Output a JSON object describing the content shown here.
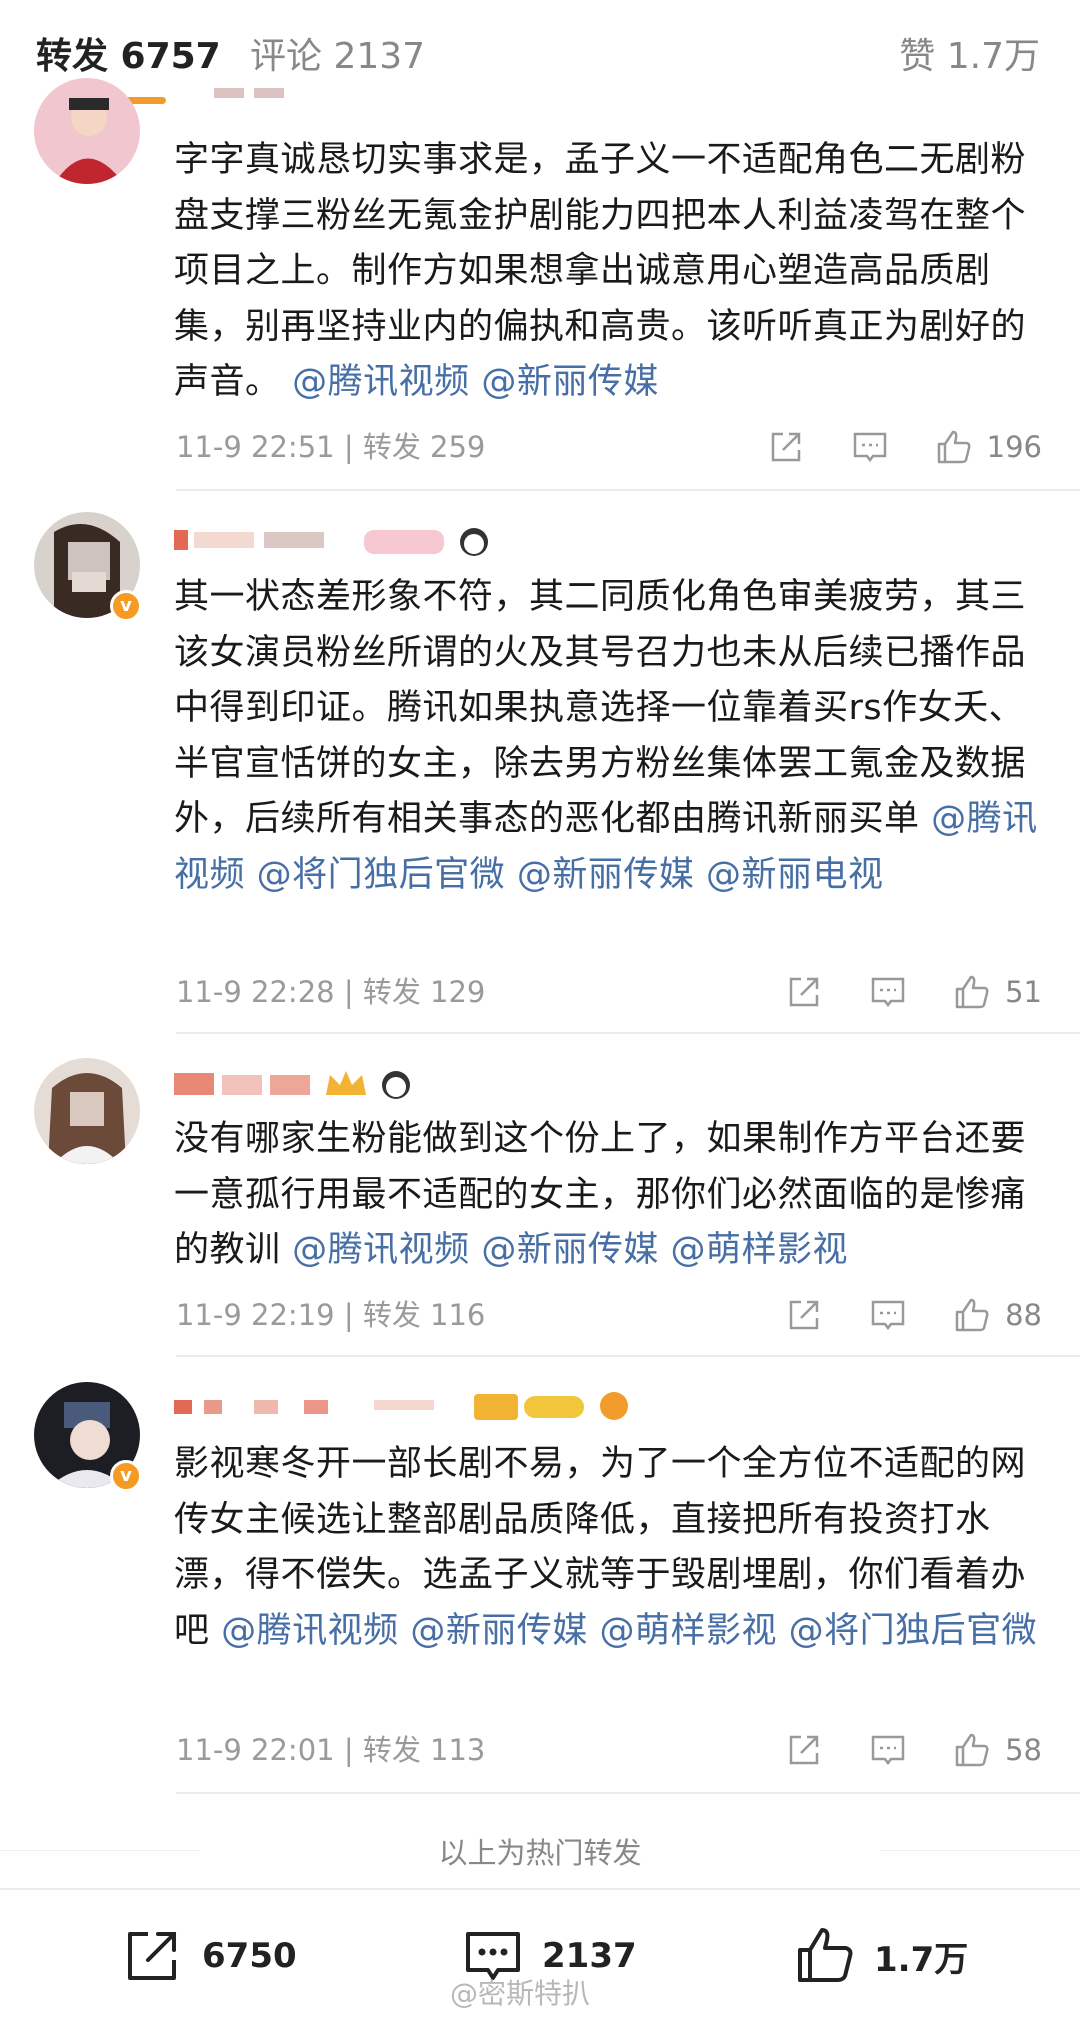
{
  "tabs": {
    "repost_label": "转发 6757",
    "comment_label": "评论 2137",
    "like_label": "赞 1.7万"
  },
  "items": [
    {
      "text": "字字真诚恳切实事求是，孟子义一不适配角色二无剧粉盘支撑三粉丝无氪金护剧能力四把本人利益凌驾在整个项目之上。制作方如果想拿出诚意用心塑造高品质剧集，别再坚持业内的偏执和高贵。该听听真正为剧好的声音。",
      "mentions": [
        "@腾讯视频",
        "@新丽传媒"
      ],
      "meta": "11-9 22:51 | 转发 259",
      "likes": "196"
    },
    {
      "text": "其一状态差形象不符，其二同质化角色审美疲劳，其三该女演员粉丝所谓的火及其号召力也未从后续已播作品中得到印证。腾讯如果执意选择一位靠着买rs作女夭、半官宣恬饼的女主，除去男方粉丝集体罢工氪金及数据外，后续所有相关事态的恶化都由腾讯新丽买单",
      "mentions": [
        "@腾讯视频",
        "@将门独后官微",
        "@新丽传媒",
        "@新丽电视"
      ],
      "meta": "11-9 22:28 | 转发 129",
      "likes": "51"
    },
    {
      "text": "没有哪家生粉能做到这个份上了，如果制作方平台还要一意孤行用最不适配的女主，那你们必然面临的是惨痛的教训",
      "mentions": [
        "@腾讯视频",
        "@新丽传媒",
        "@萌样影视"
      ],
      "meta": "11-9 22:19 | 转发 116",
      "likes": "88"
    },
    {
      "text": "影视寒冬开一部长剧不易，为了一个全方位不适配的网传女主候选让整部剧品质降低，直接把所有投资打水漂，得不偿失。选孟子义就等于毁剧埋剧，你们看着办吧",
      "mentions": [
        "@腾讯视频",
        "@新丽传媒",
        "@萌样影视",
        "@将门独后官微"
      ],
      "meta": "11-9 22:01 | 转发 113",
      "likes": "58"
    }
  ],
  "hot_note": "以上为热门转发",
  "bottom": {
    "repost_count": "6750",
    "comment_count": "2137",
    "like_count": "1.7万"
  },
  "watermark": "@密斯特扒",
  "colors": {
    "accent": "#f39a2b",
    "mention": "#476fa6",
    "meta": "#9a9a9a"
  }
}
